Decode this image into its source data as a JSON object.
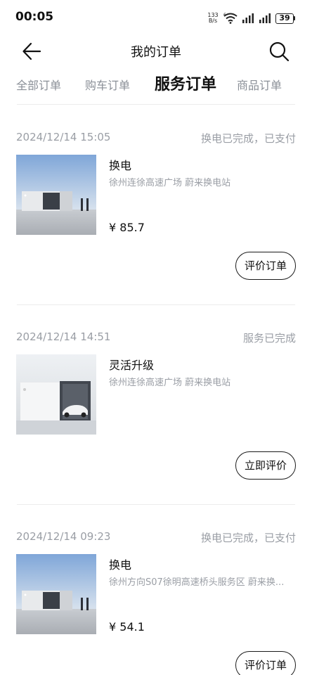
{
  "status_bar": {
    "time": "00:05",
    "net_speed_value": "133",
    "net_speed_unit": "B/s",
    "battery": "39",
    "icons": [
      "wifi-icon",
      "signal-icon",
      "signal-icon",
      "battery-icon"
    ]
  },
  "nav": {
    "title": "我的订单",
    "back_icon": "arrow-left-icon",
    "search_icon": "search-icon"
  },
  "tabs": [
    {
      "label": "全部订单",
      "active": false
    },
    {
      "label": "购车订单",
      "active": false
    },
    {
      "label": "服务订单",
      "active": true
    },
    {
      "label": "商品订单",
      "active": false
    }
  ],
  "orders": [
    {
      "time": "2024/12/14 15:05",
      "status": "换电已完成，已支付",
      "name": "换电",
      "location": "徐州连徐高速广场 蔚来换电站",
      "price": "¥ 85.7",
      "action": "评价订单"
    },
    {
      "time": "2024/12/14 14:51",
      "status": "服务已完成",
      "name": "灵活升级",
      "location": "徐州连徐高速广场 蔚来换电站",
      "price": "",
      "action": "立即评价"
    },
    {
      "time": "2024/12/14 09:23",
      "status": "换电已完成，已支付",
      "name": "换电",
      "location": "徐州方向S07徐明高速桥头服务区 蔚来换...",
      "price": "¥ 54.1",
      "action": "评价订单"
    }
  ],
  "colors": {
    "text_primary": "#111111",
    "text_secondary": "#9a9ea5",
    "divider": "#ececec"
  }
}
